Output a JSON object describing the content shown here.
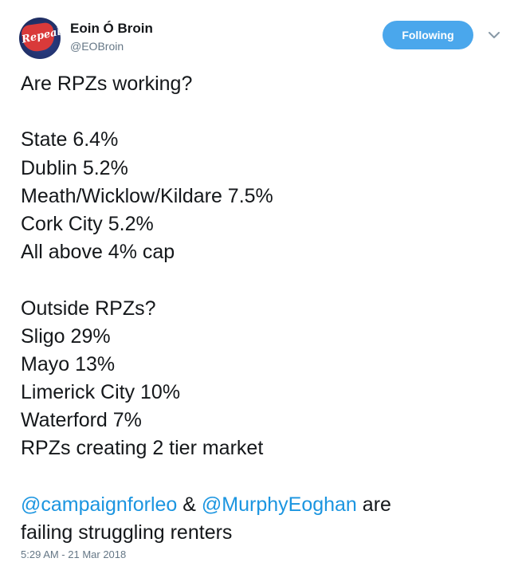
{
  "author": {
    "display_name": "Eoin Ó Broin",
    "handle": "@EOBroin",
    "avatar_text": "Repeal"
  },
  "follow_button": {
    "label": "Following"
  },
  "menu": {
    "icon": "chevron-down-icon"
  },
  "tweet": {
    "heading": "Are RPZs working?",
    "rpz_lines": [
      "State 6.4%",
      "Dublin 5.2%",
      "Meath/Wicklow/Kildare 7.5%",
      "Cork City 5.2%",
      "All above 4% cap"
    ],
    "outside_heading": "Outside RPZs?",
    "outside_lines": [
      "Sligo 29%",
      "Mayo 13%",
      "Limerick City 10%",
      "Waterford 7%",
      "RPZs creating 2 tier market"
    ],
    "closing": {
      "mention_1": "@campaignforleo",
      "connector": " & ",
      "mention_2": "@MurphyEoghan",
      "after_mention": " are",
      "line_2": "failing struggling renters"
    }
  },
  "timestamp": "5:29 AM - 21 Mar 2018",
  "colors": {
    "follow_button": "#4aa7ec",
    "mention": "#1b95e0",
    "secondary_text": "#657786"
  }
}
